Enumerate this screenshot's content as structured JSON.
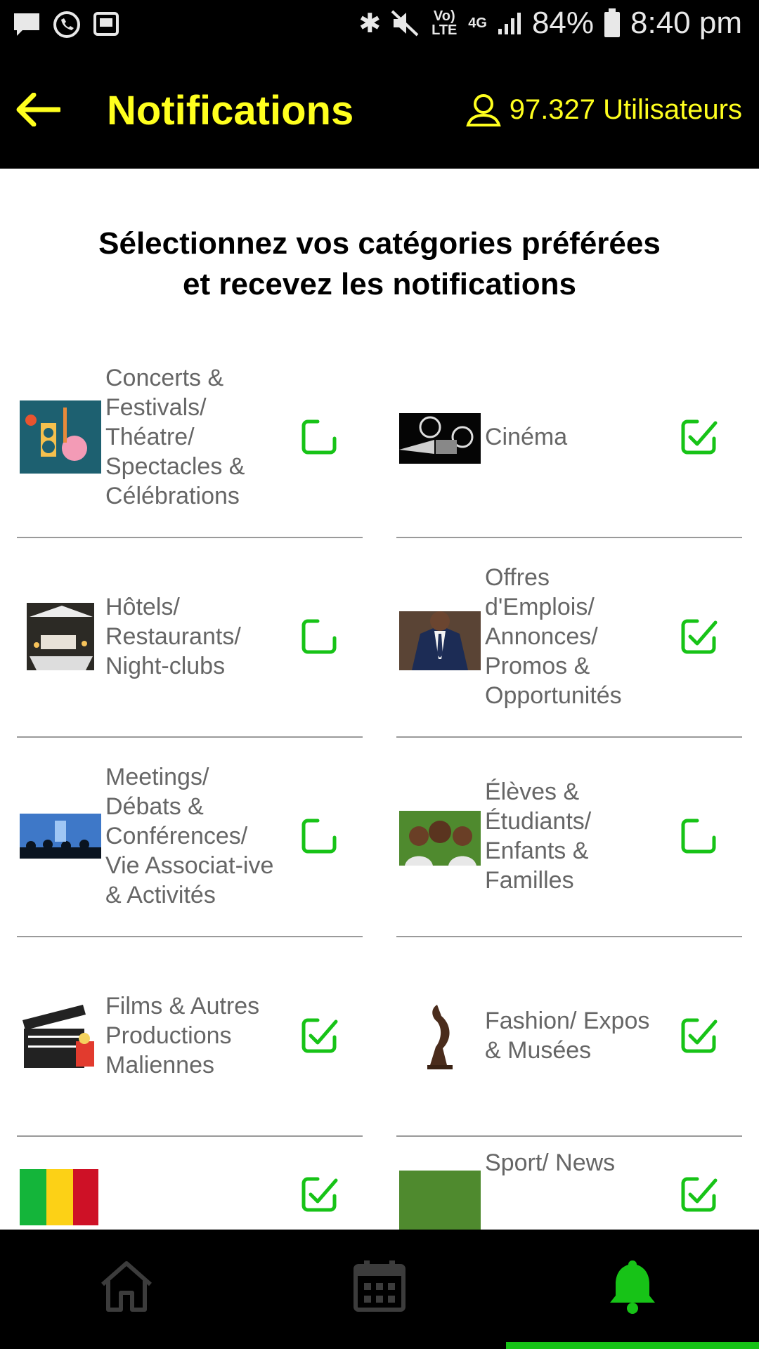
{
  "status": {
    "battery": "84%",
    "time": "8:40 pm",
    "network": "4G",
    "volte": "Vo) LTE"
  },
  "header": {
    "title": "Notifications",
    "users": "97.327 Utilisateurs"
  },
  "intro": {
    "line1": "Sélectionnez vos catégories préférées",
    "line2": "et recevez les notifications"
  },
  "categories": [
    {
      "label": "Concerts & Festivals/ Théatre/ Spectacles & Célébrations",
      "checked": false
    },
    {
      "label": "Cinéma",
      "checked": true
    },
    {
      "label": "Hôtels/ Restaurants/ Night-clubs",
      "checked": false
    },
    {
      "label": "Offres d'Emplois/ Annonces/ Promos & Opportunités",
      "checked": true
    },
    {
      "label": "Meetings/ Débats & Conférences/ Vie Associat-ive & Activités",
      "checked": false
    },
    {
      "label": "Élèves & Étudiants/ Enfants & Familles",
      "checked": false
    },
    {
      "label": "Films & Autres Productions Maliennes",
      "checked": true
    },
    {
      "label": "Fashion/ Expos & Musées",
      "checked": true
    },
    {
      "label": "",
      "checked": true
    },
    {
      "label": "Sport/ News",
      "checked": true
    }
  ],
  "nav": {
    "active": "notifications",
    "items": [
      "home",
      "calendar",
      "notifications"
    ]
  },
  "colors": {
    "accent_yellow": "#ffff1e",
    "accent_green": "#17c317",
    "background": "#ffffff",
    "bar": "#000000"
  }
}
